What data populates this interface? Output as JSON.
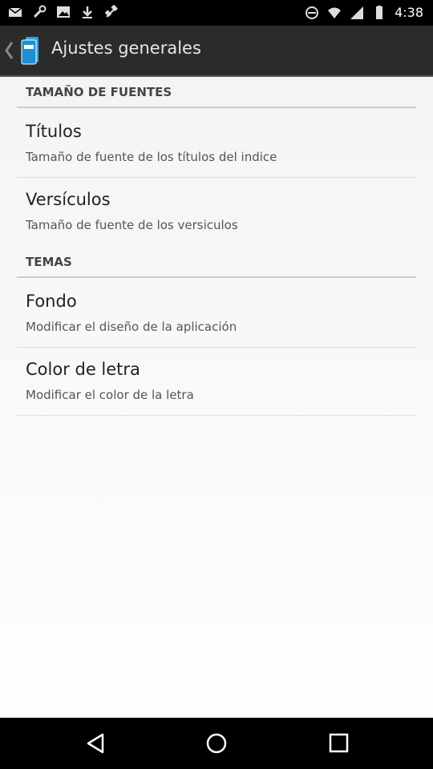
{
  "status_bar": {
    "time": "4:38",
    "left_icons": [
      "mail-icon",
      "wrench-icon",
      "photo-icon",
      "download-icon",
      "satellite-icon"
    ],
    "right_icons": [
      "blocked-icon",
      "wifi-icon",
      "signal-icon",
      "battery-icon"
    ]
  },
  "action_bar": {
    "title": "Ajustes generales"
  },
  "sections": [
    {
      "header": "TAMAÑO DE FUENTES",
      "items": [
        {
          "title": "Títulos",
          "subtitle": "Tamaño de fuente de los títulos del indice"
        },
        {
          "title": "Versículos",
          "subtitle": "Tamaño de fuente de los versiculos"
        }
      ]
    },
    {
      "header": "TEMAS",
      "items": [
        {
          "title": "Fondo",
          "subtitle": "Modificar el diseño de la aplicación"
        },
        {
          "title": "Color de letra",
          "subtitle": "Modificar el color de la letra"
        }
      ]
    }
  ],
  "nav_bar": {
    "buttons": [
      "back-icon",
      "home-icon",
      "recents-icon"
    ]
  }
}
